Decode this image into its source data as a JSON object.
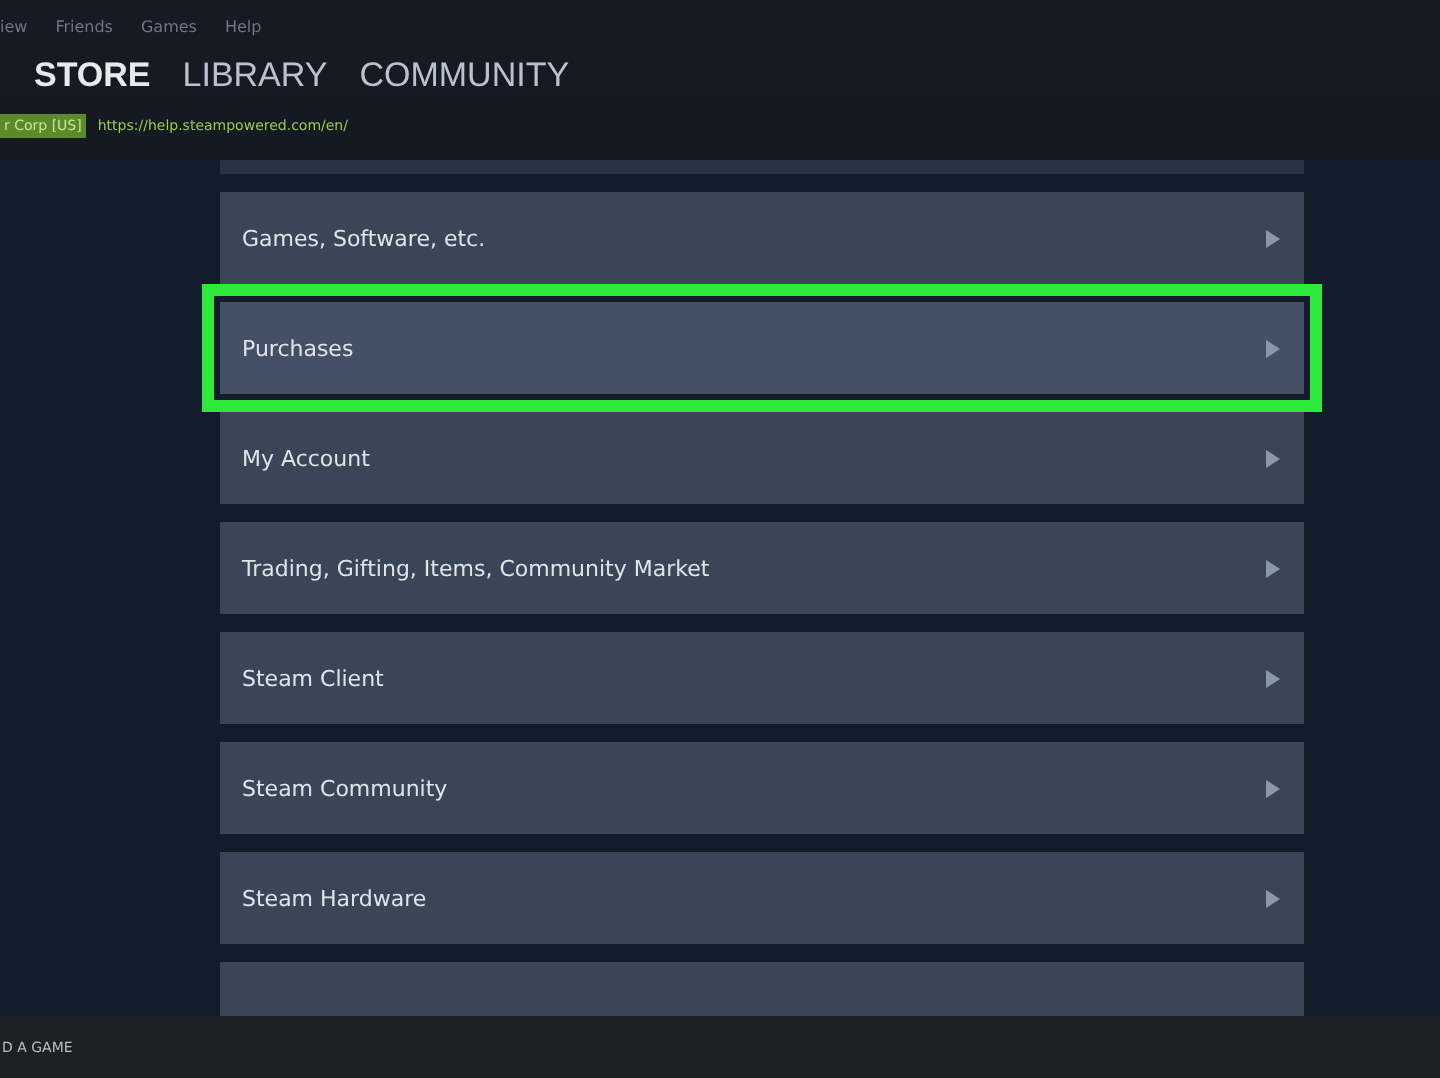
{
  "menu_bar": {
    "items": [
      "iew",
      "Friends",
      "Games",
      "Help"
    ]
  },
  "nav": {
    "items": [
      {
        "label": "STORE",
        "selected": true
      },
      {
        "label": "LIBRARY",
        "selected": false
      },
      {
        "label": "COMMUNITY",
        "selected": false
      }
    ]
  },
  "address_bar": {
    "badge": "r Corp [US]",
    "url": "https://help.steampowered.com/en/"
  },
  "help_topics": [
    {
      "label": "Games, Software, etc.",
      "selected": false
    },
    {
      "label": "Purchases",
      "selected": true
    },
    {
      "label": "My Account",
      "selected": false
    },
    {
      "label": "Trading, Gifting, Items, Community Market",
      "selected": false
    },
    {
      "label": "Steam Client",
      "selected": false
    },
    {
      "label": "Steam Community",
      "selected": false
    },
    {
      "label": "Steam Hardware",
      "selected": false
    },
    {
      "selected": false
    }
  ],
  "bottom_bar": {
    "add_game": "D A GAME"
  }
}
